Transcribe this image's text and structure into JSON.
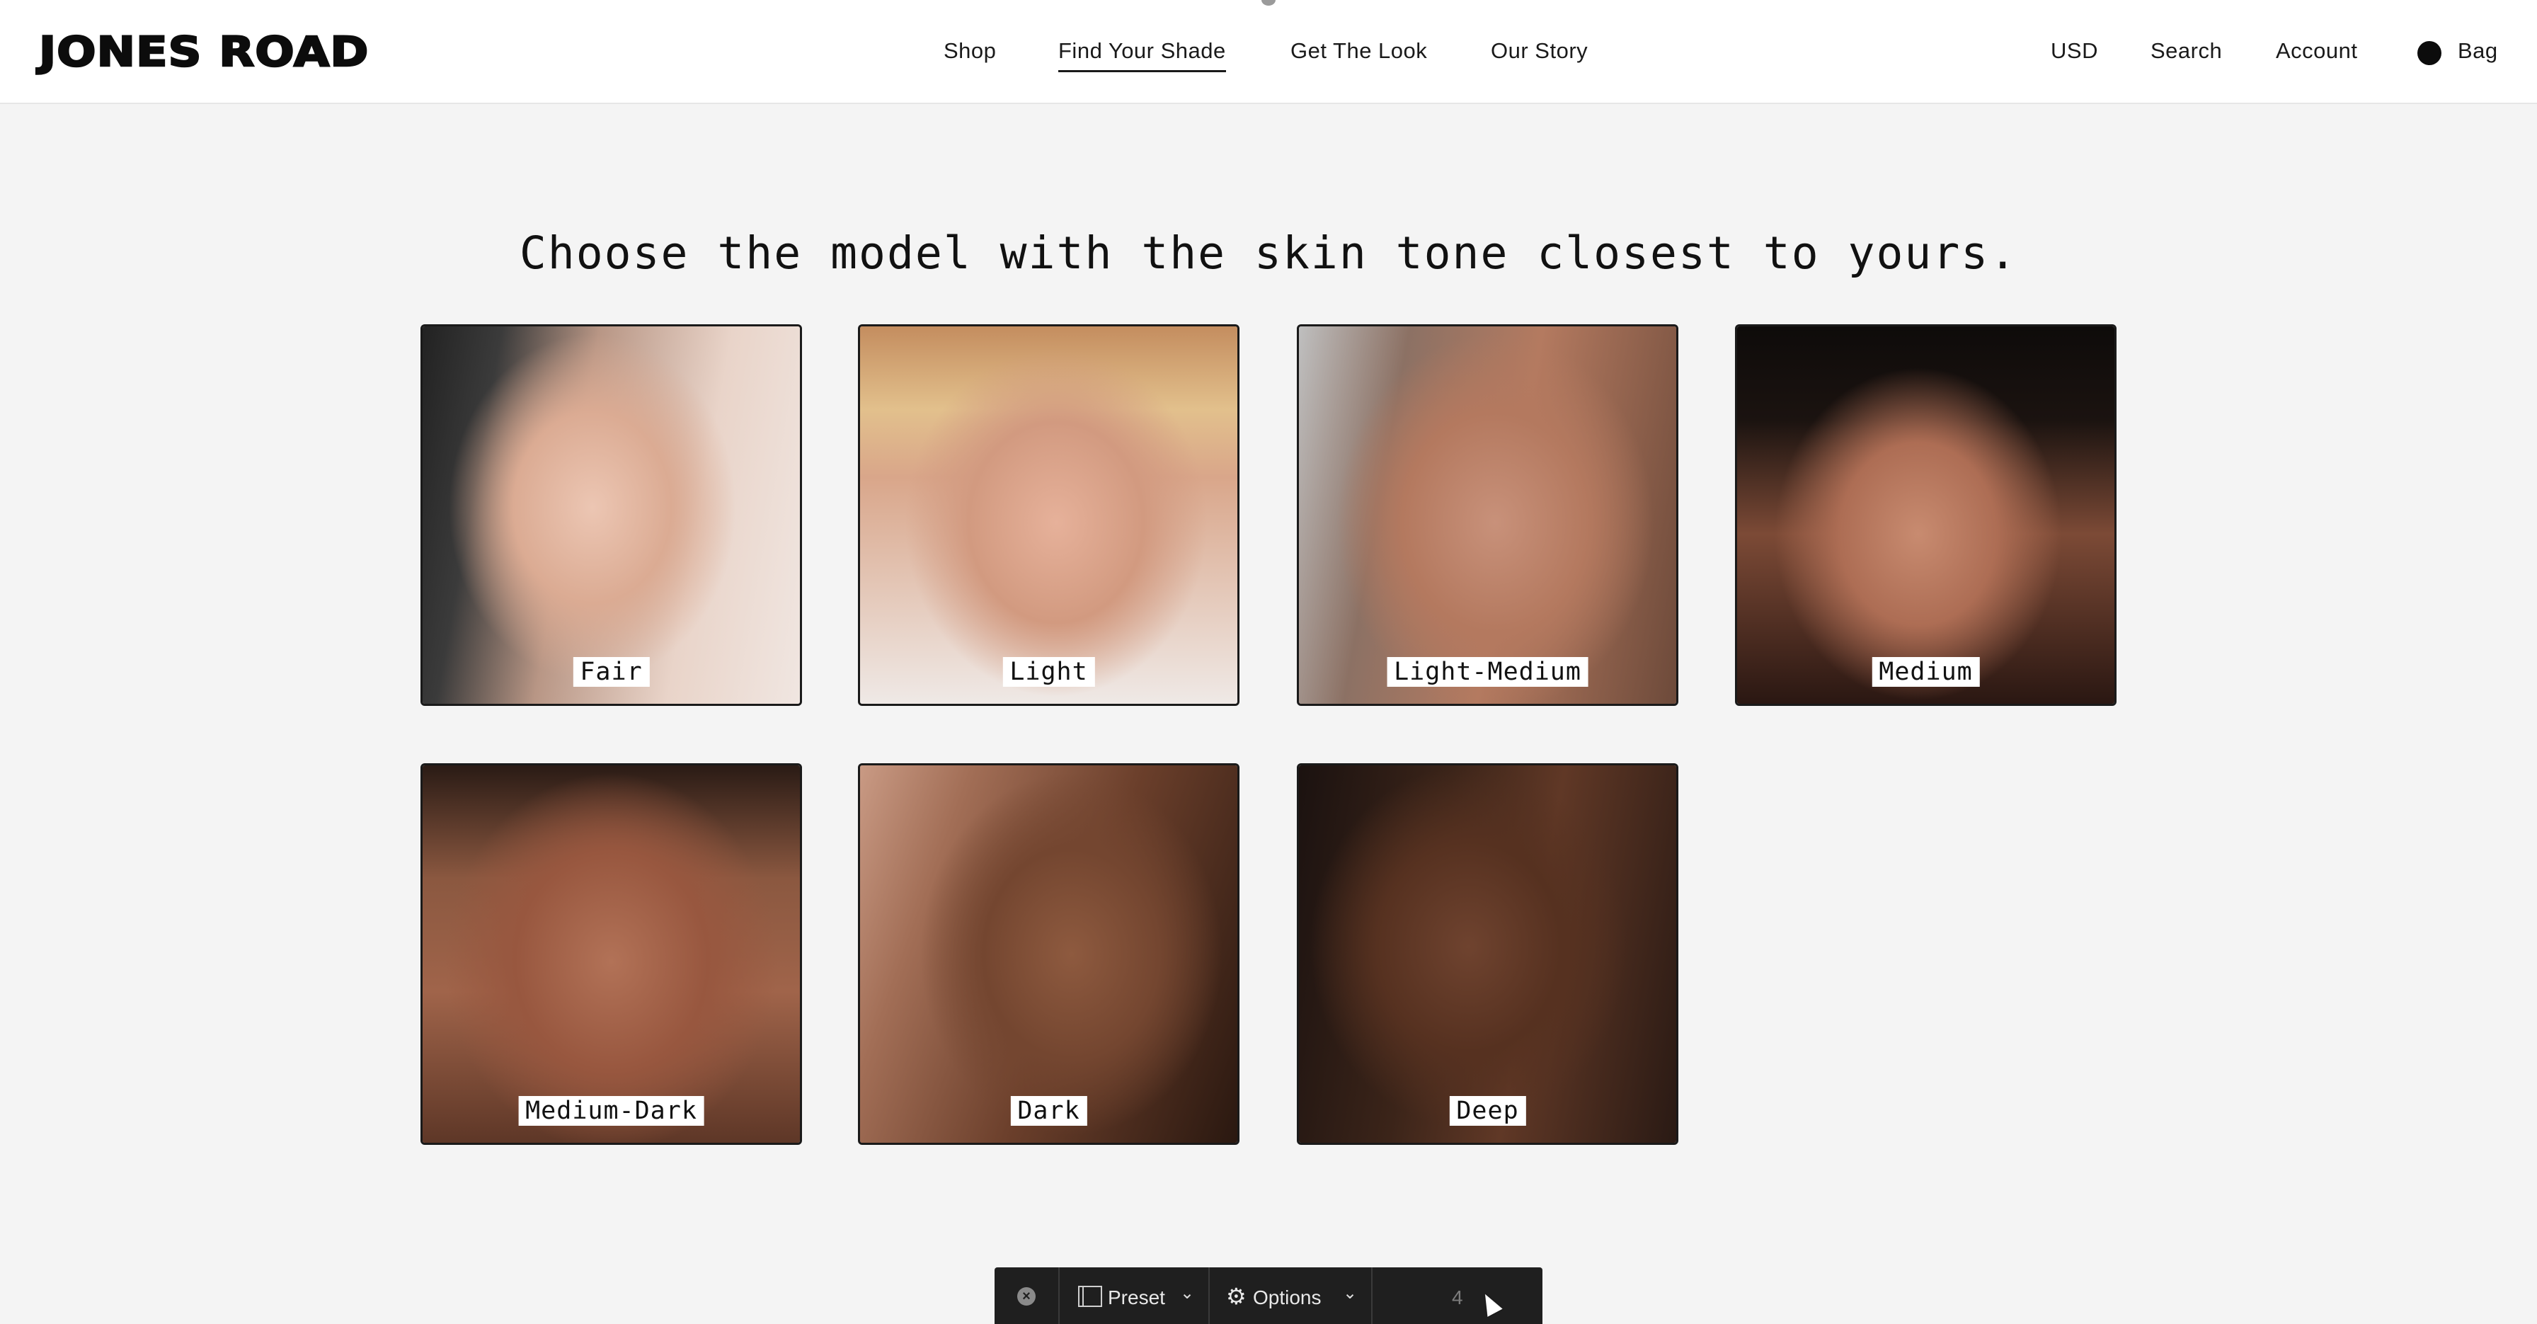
{
  "header": {
    "logo": "JONES ROAD",
    "nav": [
      "Shop",
      "Find Your Shade",
      "Get The Look",
      "Our Story"
    ],
    "active_nav": "Find Your Shade",
    "utility": {
      "currency": "USD",
      "search": "Search",
      "account": "Account",
      "bag": "Bag"
    }
  },
  "main": {
    "heading": "Choose the model with the skin tone closest to yours.",
    "shades": [
      {
        "label": "Fair"
      },
      {
        "label": "Light"
      },
      {
        "label": "Light-Medium"
      },
      {
        "label": "Medium"
      },
      {
        "label": "Medium-Dark"
      },
      {
        "label": "Dark"
      },
      {
        "label": "Deep"
      }
    ]
  },
  "toolbar": {
    "close_icon": "close-circle-icon",
    "preset_icon": "preset-icon",
    "preset_label": "Preset",
    "options_icon": "gear-icon",
    "options_label": "Options",
    "number": "4"
  },
  "colors": {
    "background": "#f4f4f4",
    "header_bg": "#ffffff",
    "text": "#111111",
    "toolbar_bg": "#1f1f1f"
  }
}
